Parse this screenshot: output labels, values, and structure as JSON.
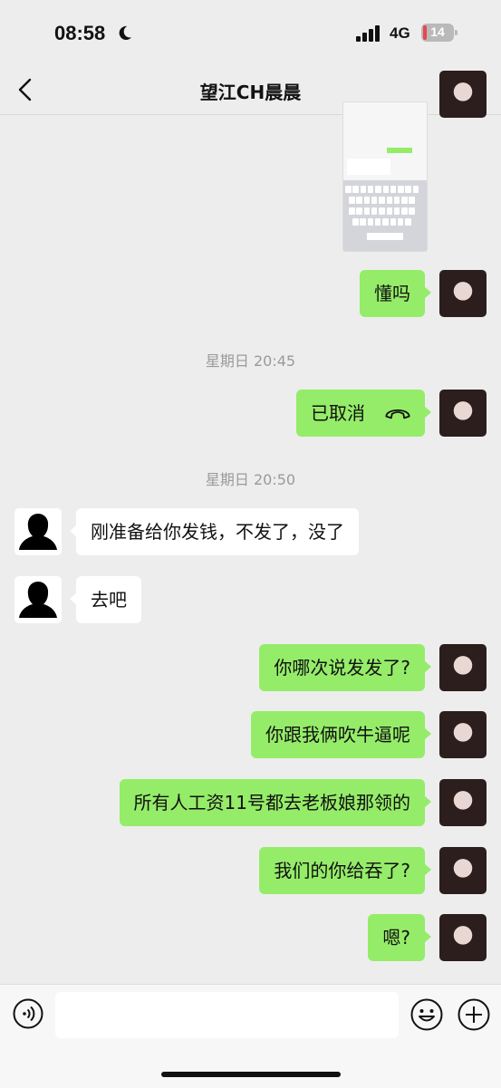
{
  "status": {
    "time": "08:58",
    "network": "4G",
    "battery": "14",
    "battery_level_pct": 14
  },
  "nav": {
    "title": "望江CH晨晨"
  },
  "messages": {
    "m1": "懂吗",
    "ts1": "星期日 20:45",
    "m2": "已取消",
    "ts2": "星期日 20:50",
    "m3": "刚准备给你发钱，不发了，没了",
    "m4": "去吧",
    "m5": "你哪次说发发了?",
    "m6": "你跟我俩吹牛逼呢",
    "m7": "所有人工资11号都去老板娘那领的",
    "m8": "我们的你给吞了?",
    "m9": "嗯?"
  },
  "colors": {
    "bubble_out": "#95ec69",
    "bubble_in": "#ffffff",
    "background": "#ededed"
  },
  "icons": {
    "back": "chevron-left-icon",
    "more": "more-icon",
    "call": "phone-hangup-icon",
    "voice": "voice-icon",
    "emoji": "emoji-icon",
    "plus": "plus-icon",
    "moon": "moon-icon"
  }
}
